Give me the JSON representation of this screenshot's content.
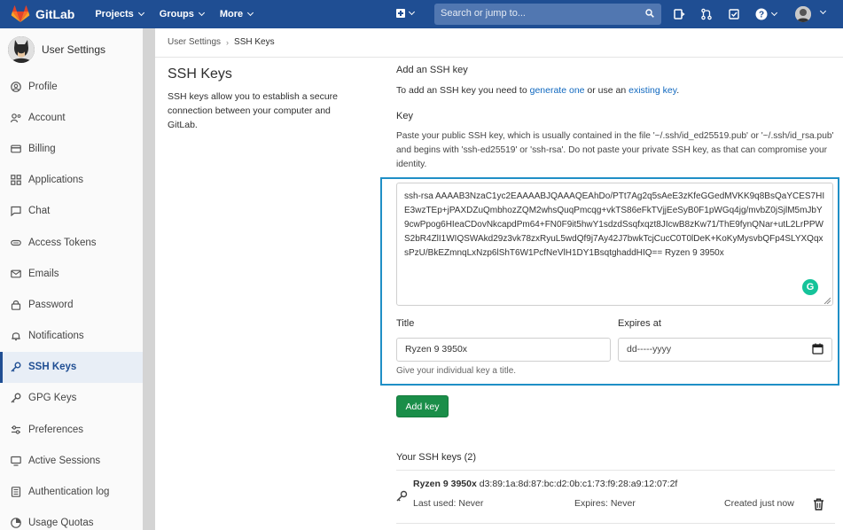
{
  "navbar": {
    "brand": "GitLab",
    "menus": [
      "Projects",
      "Groups",
      "More"
    ],
    "search_placeholder": "Search or jump to..."
  },
  "sidebar": {
    "title": "User Settings",
    "items": [
      {
        "label": "Profile",
        "icon": "profile-icon"
      },
      {
        "label": "Account",
        "icon": "account-icon"
      },
      {
        "label": "Billing",
        "icon": "billing-icon"
      },
      {
        "label": "Applications",
        "icon": "applications-icon"
      },
      {
        "label": "Chat",
        "icon": "chat-icon"
      },
      {
        "label": "Access Tokens",
        "icon": "access-tokens-icon"
      },
      {
        "label": "Emails",
        "icon": "emails-icon"
      },
      {
        "label": "Password",
        "icon": "lock-icon"
      },
      {
        "label": "Notifications",
        "icon": "bell-icon"
      },
      {
        "label": "SSH Keys",
        "icon": "key-icon",
        "active": true
      },
      {
        "label": "GPG Keys",
        "icon": "key-icon"
      },
      {
        "label": "Preferences",
        "icon": "preferences-icon"
      },
      {
        "label": "Active Sessions",
        "icon": "monitor-icon"
      },
      {
        "label": "Authentication log",
        "icon": "log-icon"
      },
      {
        "label": "Usage Quotas",
        "icon": "quota-icon"
      }
    ]
  },
  "breadcrumb": {
    "parent": "User Settings",
    "current": "SSH Keys"
  },
  "page": {
    "title": "SSH Keys",
    "description": "SSH keys allow you to establish a secure connection between your computer and GitLab."
  },
  "add_key": {
    "section_title": "Add an SSH key",
    "desc_prefix": "To add an SSH key you need to ",
    "generate_link": "generate one",
    "desc_middle": " or use an ",
    "existing_link": "existing key",
    "desc_suffix": ".",
    "key_label": "Key",
    "key_help": "Paste your public SSH key, which is usually contained in the file '~/.ssh/id_ed25519.pub' or '~/.ssh/id_rsa.pub' and begins with 'ssh-ed25519' or 'ssh-rsa'. Do not paste your private SSH key, as that can compromise your identity.",
    "key_value": "ssh-rsa AAAAB3NzaC1yc2EAAAABJQAAAQEAhDo/PTt7Ag2q5sAeE3zKfeGGedMVKK9q8BsQaYCES7HIE3wzTEp+jPAXDZuQmbhozZQM2whsQuqPmcqg+vkTS86eFkTVjjEeSyB0F1pWGq4jg/mvbZ0jSjlM5mJbY9cwPpog6HIeaCDovNkcapdPm64+FN0F9it5hwY1sdzdSsqfxqzt8JIcwB8zKw71/ThE9fynQNar+utL2LrPPWS2bR4ZlI1WIQSWAkd29z3vk78zxRyuL5wdQf9j7Ay42J7bwkTcjCucC0T0lDeK+KoKyMysvbQFp4SLYXQqxsPzU/BkEZmnqLxNzp6lShT6W1PcfNeVlH1DY1BsqtghaddHIQ== Ryzen 9 3950x",
    "title_label": "Title",
    "title_value": "Ryzen 9 3950x",
    "title_help": "Give your individual key a title.",
    "expires_label": "Expires at",
    "expires_placeholder": "dd-----yyyy",
    "add_button": "Add key"
  },
  "your_keys": {
    "heading": "Your SSH keys (2)",
    "keys": [
      {
        "title": "Ryzen 9 3950x",
        "fingerprint": "d3:89:1a:8d:87:bc:d2:0b:c1:73:f9:28:a9:12:07:2f",
        "last_used": "Last used: Never",
        "expires": "Expires: Never",
        "created": "Created just now"
      }
    ]
  },
  "colors": {
    "navbar": "#1f4e93",
    "link": "#1068bf",
    "add_button": "#1a8e49",
    "highlight_border": "#1f8fc6"
  }
}
